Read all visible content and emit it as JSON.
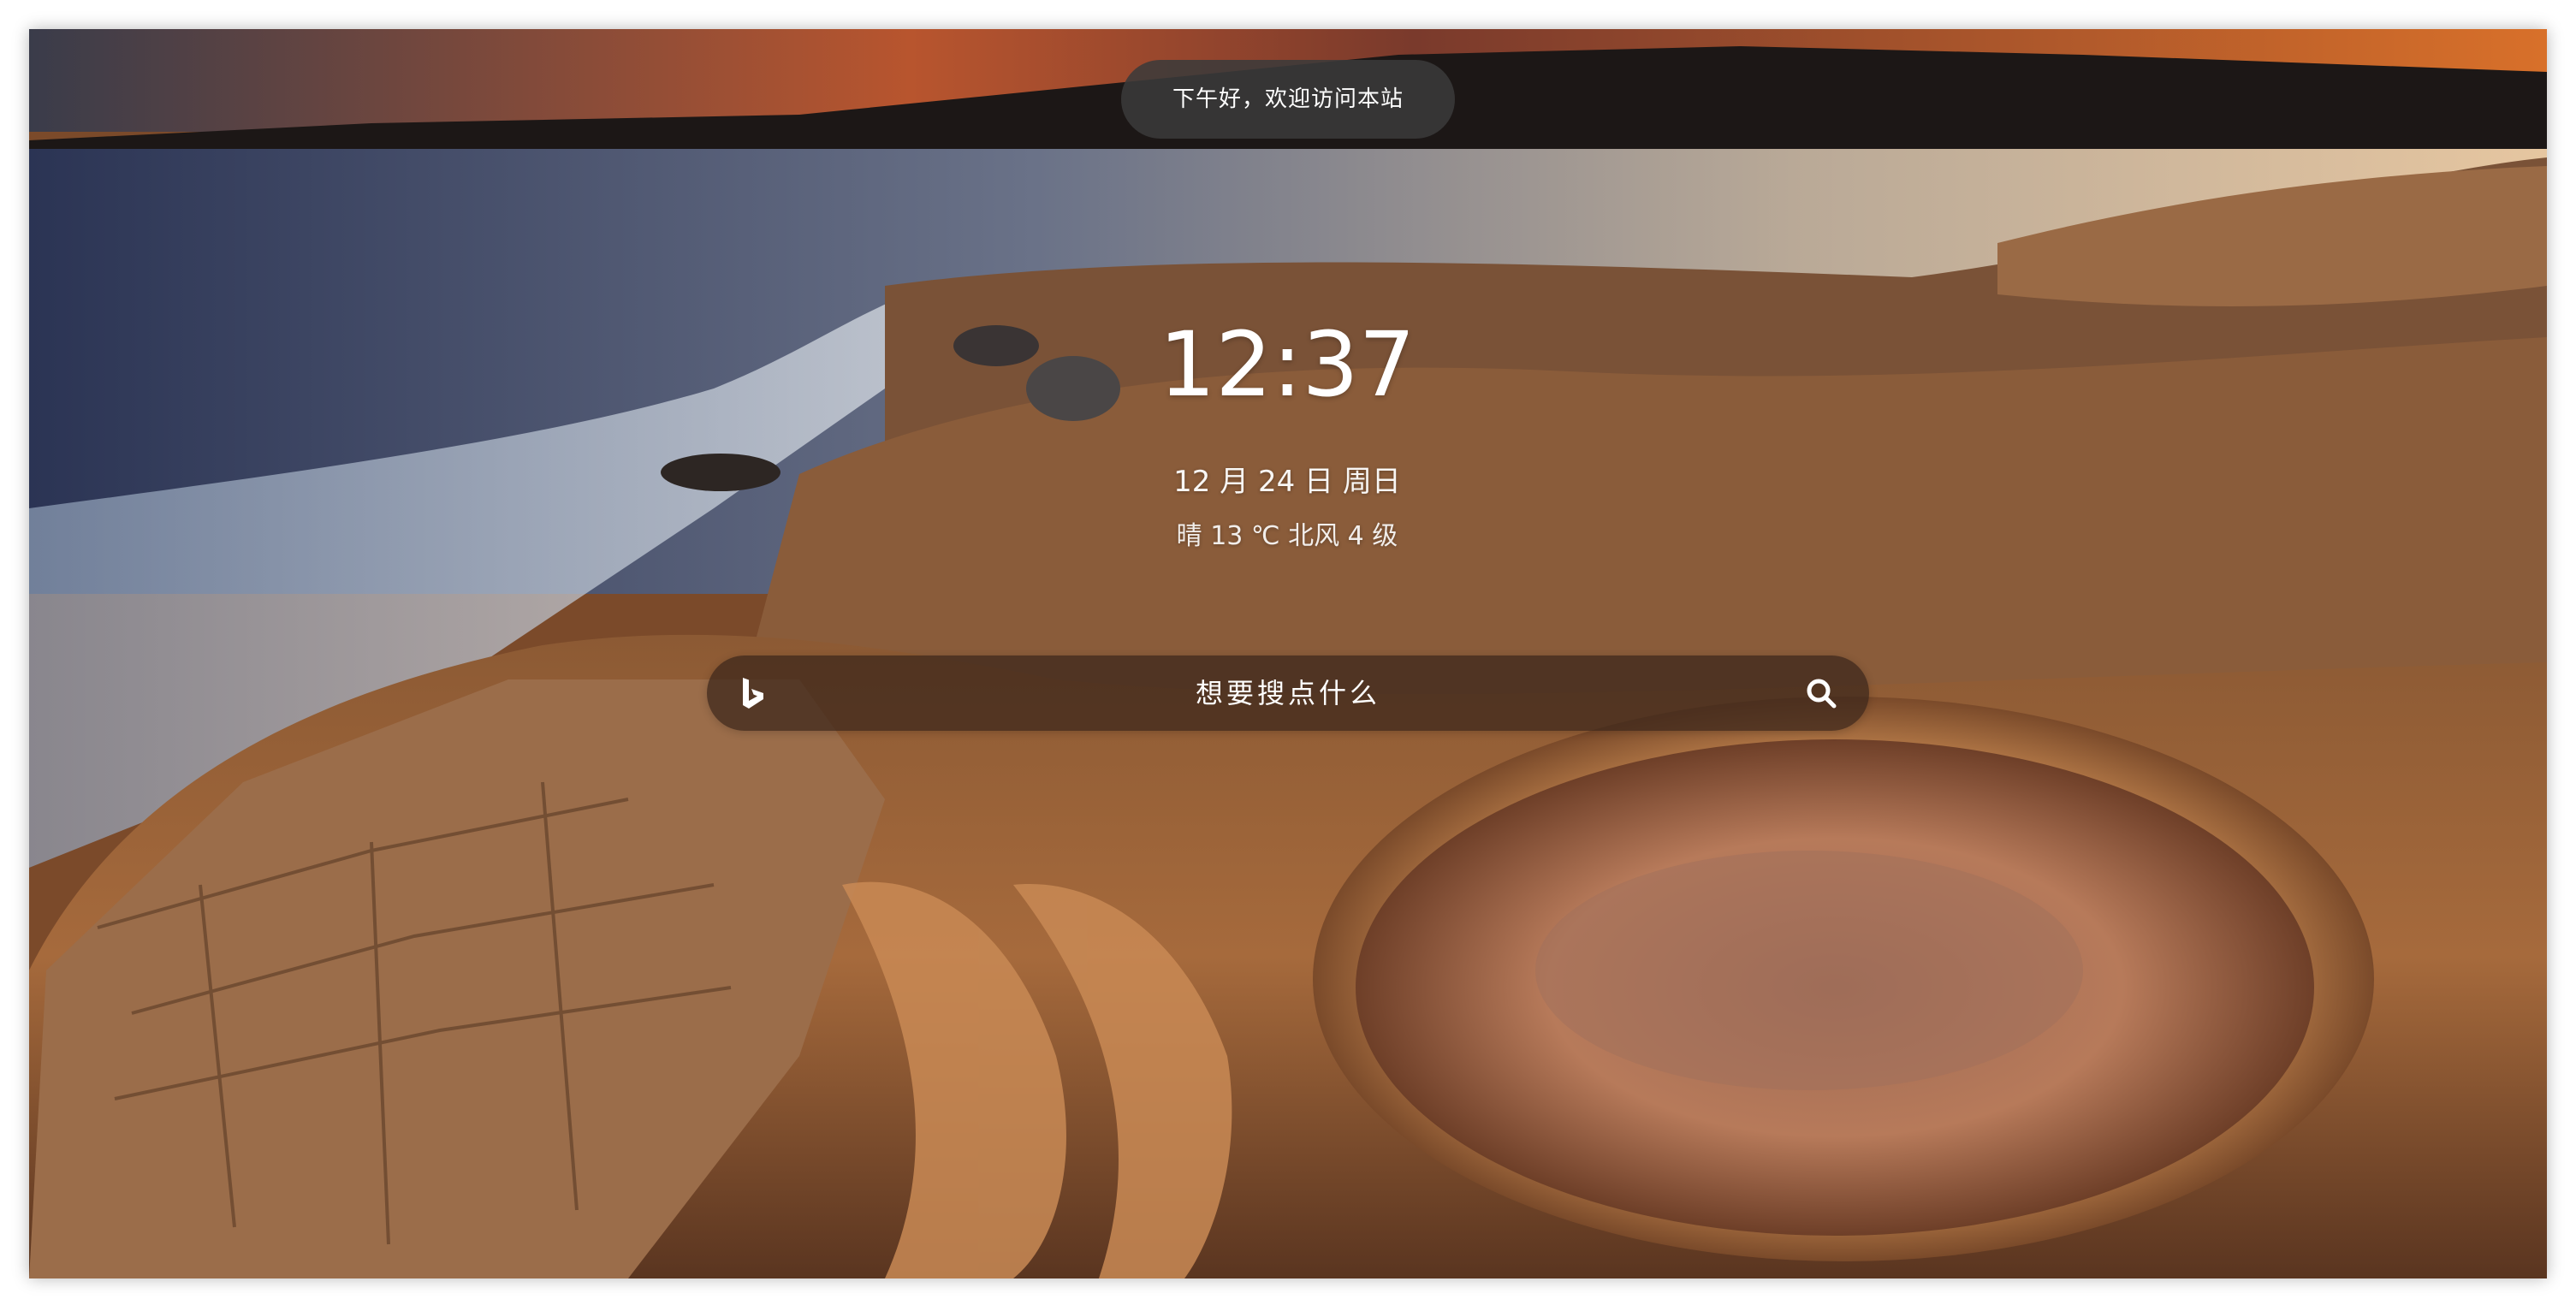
{
  "greeting": "下午好，欢迎访问本站",
  "clock": "12:37",
  "date": "12 月 24 日 周日",
  "weather": "晴 13 ℃ 北风 4 级",
  "search": {
    "placeholder": "想要搜点什么",
    "engine_icon": "bing-icon",
    "submit_icon": "search-icon"
  },
  "colors": {
    "pill_bg": "#3a3a3a",
    "text": "#ffffff",
    "search_bg": "#3a261a"
  }
}
